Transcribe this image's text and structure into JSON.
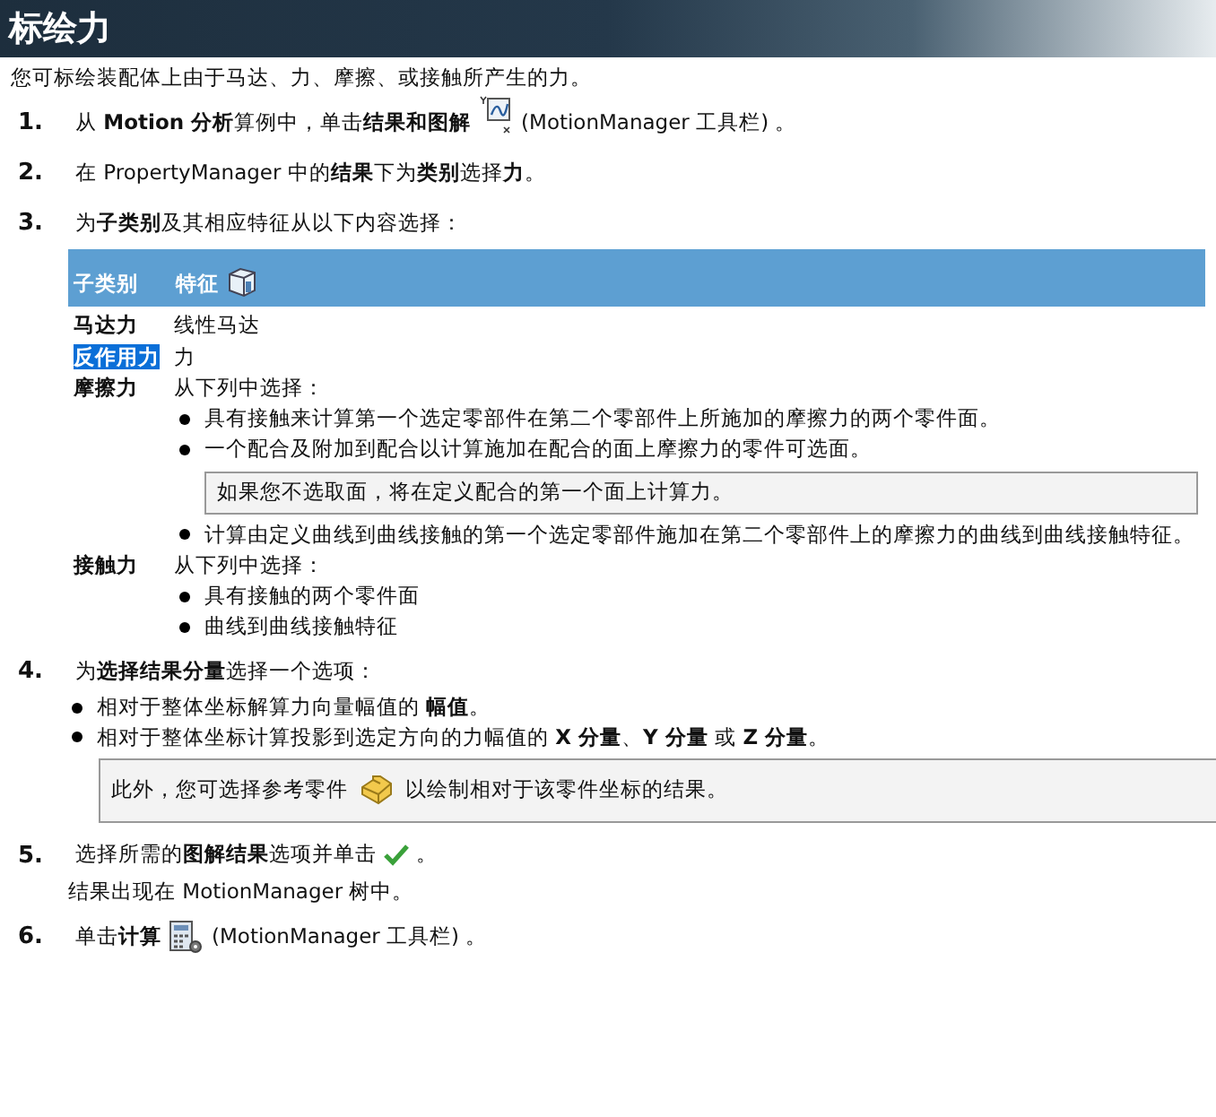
{
  "title": "标绘力",
  "intro": "您可标绘装配体上由于马达、力、摩擦、或接触所产生的力。",
  "steps": [
    {
      "number": "1.",
      "text": "从 **Motion 分析**算例中，单击**结果和图解**",
      "text_after": "(MotionManager 工具栏) 。"
    },
    {
      "number": "2.",
      "text": "在 PropertyManager 中的**结果**下为**类别**选择**力**。"
    },
    {
      "number": "3.",
      "text": "为**子类别**及其相应特征从以下内容选择：",
      "table": {
        "columns": [
          "子类别",
          "特征"
        ],
        "rows": [
          {
            "label": "马达力",
            "highlighted": false,
            "value": "线性马达"
          },
          {
            "label": "反作用力",
            "highlighted": true,
            "value": "力"
          },
          {
            "label": "摩擦力",
            "highlighted": false,
            "value": "从下列中选择：",
            "items": [
              {
                "kind": "bullet",
                "text": "具有接触来计算第一个选定零部件在第二个零部件上所施加的摩擦力的两个零件面。"
              },
              {
                "kind": "bullet",
                "text": "一个配合及附加到配合以计算施加在配合的面上摩擦力的零件可选面。"
              },
              {
                "kind": "note",
                "text": "如果您不选取面，将在定义配合的第一个面上计算力。"
              },
              {
                "kind": "bullet",
                "text": "计算由定义曲线到曲线接触的第一个选定零部件施加在第二个零部件上的摩擦力的曲线到曲线接触特征。"
              }
            ]
          },
          {
            "label": "接触力",
            "highlighted": false,
            "value": "从下列中选择：",
            "items": [
              {
                "kind": "bullet",
                "text": "具有接触的两个零件面"
              },
              {
                "kind": "bullet",
                "text": "曲线到曲线接触特征"
              }
            ]
          }
        ]
      }
    },
    {
      "number": "4.",
      "text": "为**选择结果分量**选择一个选项：",
      "bullets": [
        "相对于整体坐标解算力向量幅值的 **幅值**。",
        "相对于整体坐标计算投影到选定方向的力幅值的 **X 分量**、**Y 分量** 或 **Z 分量**。"
      ],
      "note": {
        "text": "此外，您可选择参考零件",
        "text_after": "以绘制相对于该零件坐标的结果。"
      }
    },
    {
      "number": "5.",
      "text": "选择所需的**图解结果**选项并单击",
      "text_after": "。",
      "sub": "结果出现在 MotionManager 树中。"
    },
    {
      "number": "6.",
      "text": "单击**计算**",
      "text_after": "(MotionManager 工具栏) 。"
    }
  ]
}
